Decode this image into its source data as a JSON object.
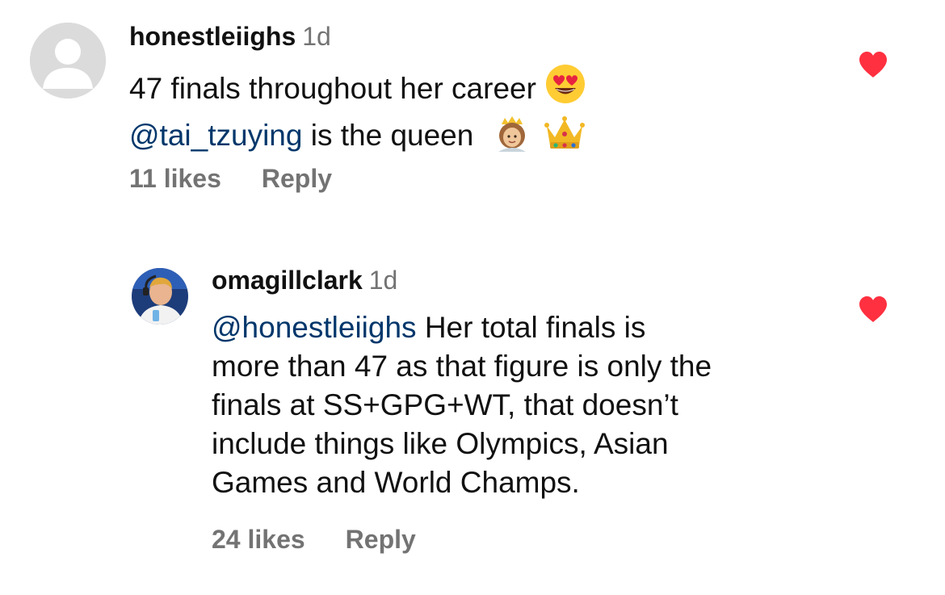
{
  "comments": [
    {
      "username": "honestleiighs",
      "time": "1d",
      "text_line1": "47 finals throughout her career",
      "emoji1": "heart-eyes-emoji",
      "mention": "@tai_tzuying",
      "text_line2": " is the queen",
      "emoji2": "princess-emoji",
      "emoji3": "crown-emoji",
      "likes": "11 likes",
      "reply_label": "Reply",
      "liked": true
    },
    {
      "username": "omagillclark",
      "time": "1d",
      "mention": "@honestleiighs",
      "line1_rest": " Her total finals is",
      "line2": "more than 47 as that figure is only the",
      "line3": "finals at SS+GPG+WT, that doesn’t",
      "line4": "include things like Olympics, Asian",
      "line5": "Games and World Champs.",
      "likes": "24 likes",
      "reply_label": "Reply",
      "liked": true
    }
  ],
  "colors": {
    "heart": "#ff3040",
    "mention": "#00376b",
    "secondary_text": "#737373"
  }
}
